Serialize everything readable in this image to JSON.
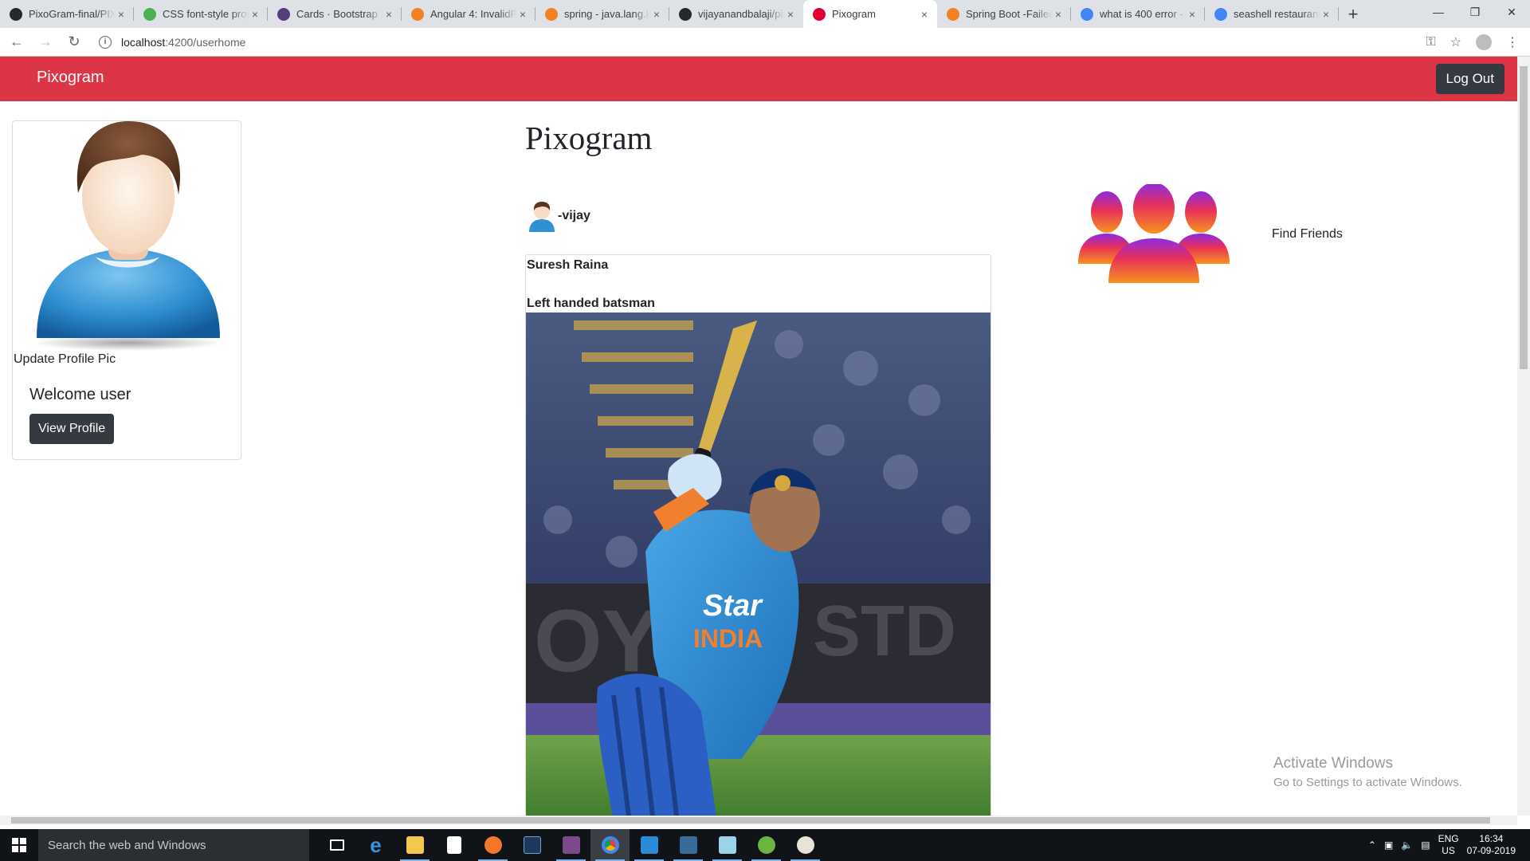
{
  "browser": {
    "tabs": [
      {
        "title": "PixoGram-final/PIXO",
        "favicon": "github-icon",
        "color": "#24292e"
      },
      {
        "title": "CSS font-style prop",
        "favicon": "w3schools-icon",
        "color": "#4caf50"
      },
      {
        "title": "Cards · Bootstrap",
        "favicon": "bootstrap-icon",
        "color": "#563d7c"
      },
      {
        "title": "Angular 4: InvalidPip",
        "favicon": "stackoverflow-icon",
        "color": "#f48024"
      },
      {
        "title": "spring - java.lang.Ille",
        "favicon": "stackoverflow-icon",
        "color": "#f48024"
      },
      {
        "title": "vijayanandbalaji/pix",
        "favicon": "github-icon",
        "color": "#24292e"
      },
      {
        "title": "Pixogram",
        "favicon": "angular-icon",
        "color": "#dd0031"
      },
      {
        "title": "Spring Boot -Failed",
        "favicon": "stackoverflow-icon",
        "color": "#f48024"
      },
      {
        "title": "what is 400 error - G",
        "favicon": "google-icon",
        "color": "#4285f4"
      },
      {
        "title": "seashell restaurant",
        "favicon": "google-icon",
        "color": "#4285f4"
      }
    ],
    "active_tab": 6,
    "url_host": "localhost",
    "url_rest": ":4200/userhome"
  },
  "navbar": {
    "brand": "Pixogram",
    "logout_label": "Log Out"
  },
  "profile": {
    "update_pic_label": "Update Profile Pic",
    "welcome": "Welcome user",
    "view_profile_label": "View Profile"
  },
  "main": {
    "title": "Pixogram",
    "post": {
      "username": "-vijay",
      "title": "Suresh Raina",
      "description": "Left handed batsman"
    }
  },
  "friends": {
    "label": "Find Friends"
  },
  "watermark": {
    "line1": "Activate Windows",
    "line2": "Go to Settings to activate Windows."
  },
  "taskbar": {
    "search_placeholder": "Search the web and Windows",
    "lang_line1": "ENG",
    "lang_line2": "US",
    "time": "16:34",
    "date": "07-09-2019"
  }
}
